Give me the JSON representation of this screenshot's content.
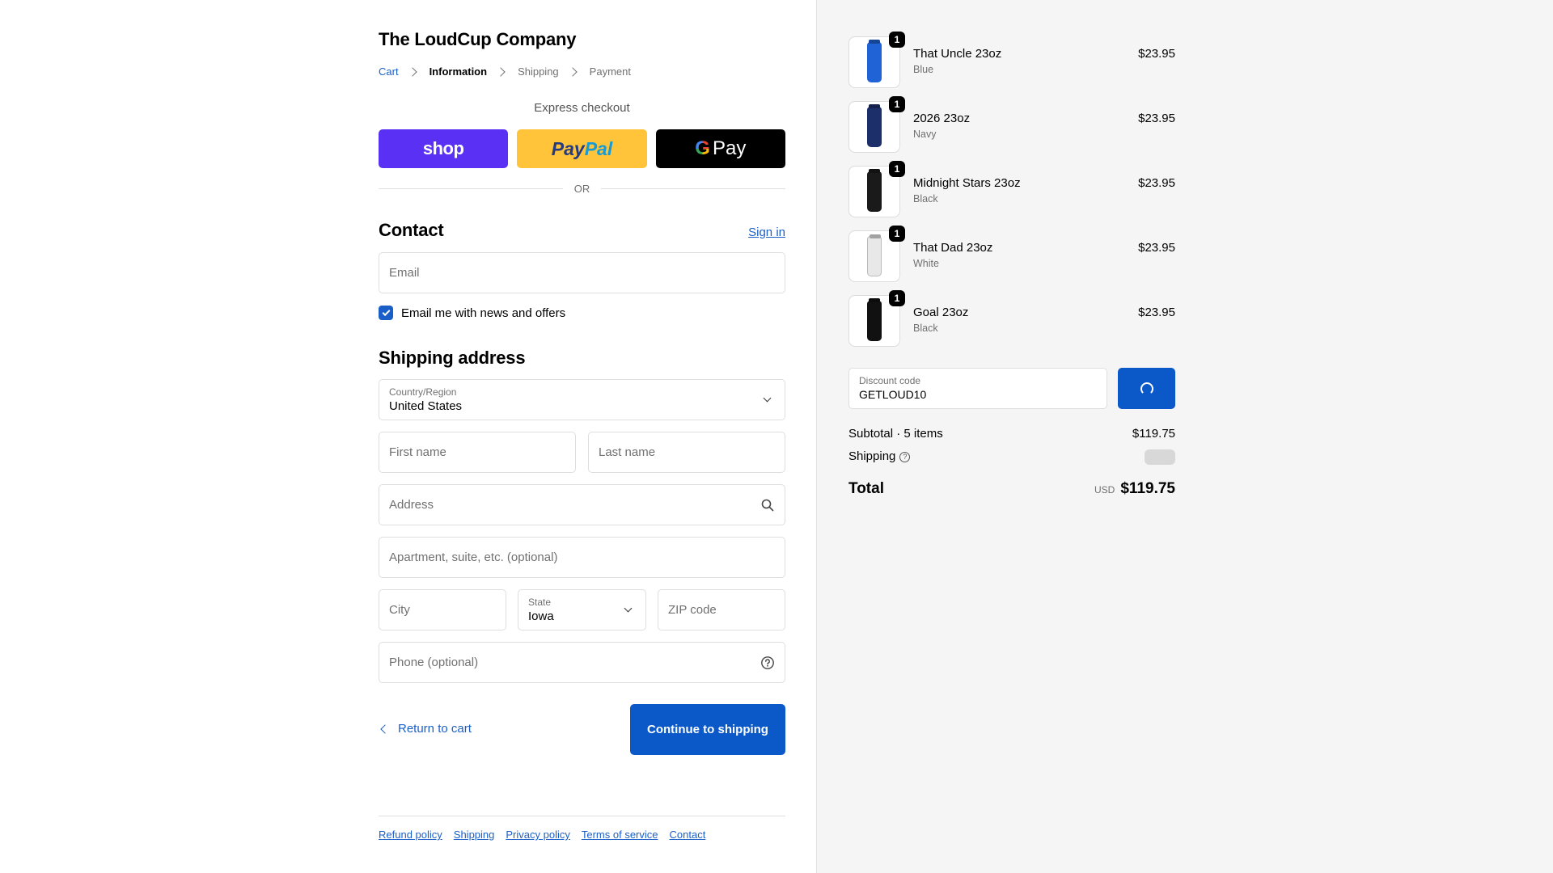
{
  "store": {
    "title": "The LoudCup Company"
  },
  "breadcrumb": [
    "Cart",
    "Information",
    "Shipping",
    "Payment"
  ],
  "express": {
    "label": "Express checkout",
    "shop": "shop",
    "paypal_a": "Pay",
    "paypal_b": "Pal",
    "gpay_g": "G",
    "gpay_pay": "Pay",
    "or": "OR"
  },
  "contact": {
    "title": "Contact",
    "signin": "Sign in",
    "email_placeholder": "Email",
    "newsletter_label": "Email me with news and offers",
    "newsletter_checked": true
  },
  "shipping": {
    "title": "Shipping address",
    "country_label": "Country/Region",
    "country_value": "United States",
    "first_name_placeholder": "First name",
    "last_name_placeholder": "Last name",
    "address_placeholder": "Address",
    "apartment_placeholder": "Apartment, suite, etc. (optional)",
    "city_placeholder": "City",
    "state_label": "State",
    "state_value": "Iowa",
    "zip_placeholder": "ZIP code",
    "phone_placeholder": "Phone (optional)"
  },
  "actions": {
    "return": "Return to cart",
    "continue": "Continue to shipping"
  },
  "footer": [
    "Refund policy",
    "Shipping",
    "Privacy policy",
    "Terms of service",
    "Contact"
  ],
  "cart": {
    "items": [
      {
        "name": "That Uncle 23oz",
        "variant": "Blue",
        "price": "$23.95",
        "qty": "1",
        "color": "#1f63d6"
      },
      {
        "name": "2026 23oz",
        "variant": "Navy",
        "price": "$23.95",
        "qty": "1",
        "color": "#1d2f6b"
      },
      {
        "name": "Midnight Stars 23oz",
        "variant": "Black",
        "price": "$23.95",
        "qty": "1",
        "color": "#1a1a1a"
      },
      {
        "name": "That Dad 23oz",
        "variant": "White",
        "price": "$23.95",
        "qty": "1",
        "color": "#e8e8e8"
      },
      {
        "name": "Goal 23oz",
        "variant": "Black",
        "price": "$23.95",
        "qty": "1",
        "color": "#111111"
      }
    ],
    "discount_label": "Discount code",
    "discount_value": "GETLOUD10",
    "subtotal_label": "Subtotal · 5 items",
    "subtotal_value": "$119.75",
    "shipping_label": "Shipping",
    "total_label": "Total",
    "currency": "USD",
    "total_value": "$119.75"
  },
  "colors": {
    "accent": "#0b59c9",
    "link": "#1a5fc8",
    "shop": "#5a31f4",
    "paypal": "#ffc439"
  },
  "icons": [
    "chevron-right-icon",
    "chevron-down-icon",
    "search-icon",
    "help-icon",
    "check-icon",
    "chevron-left-icon",
    "spinner-icon"
  ]
}
